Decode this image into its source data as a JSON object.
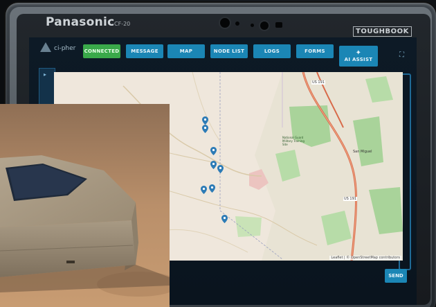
{
  "device": {
    "brand": "Panasonic",
    "model": "CF-20",
    "badge": "TOUGHBOOK"
  },
  "app": {
    "logo_text": "ci-pher",
    "nav": [
      {
        "label": "CONNECTED",
        "status": "connected"
      },
      {
        "label": "MESSAGE"
      },
      {
        "label": "MAP"
      },
      {
        "label": "NODE LIST"
      },
      {
        "label": "LOGS"
      },
      {
        "label": "FORMS"
      },
      {
        "label": "AI ASSIST"
      }
    ],
    "send_label": "SEND",
    "map": {
      "zoom_in": "+",
      "zoom_out": "−",
      "attribution": "Leaflet | © OpenStreetMap contributors",
      "road_label_1": "US 191",
      "road_label_2": "US 191",
      "town_label": "San Miguel",
      "park_label": "National Guard Military Training Site"
    }
  },
  "colors": {
    "accent": "#1b86b5",
    "connected": "#3aa94a",
    "pin": "#2c7bb6",
    "map_bg": "#efe7dc",
    "park_green": "#a9d39a",
    "highway": "#d86a4a"
  }
}
